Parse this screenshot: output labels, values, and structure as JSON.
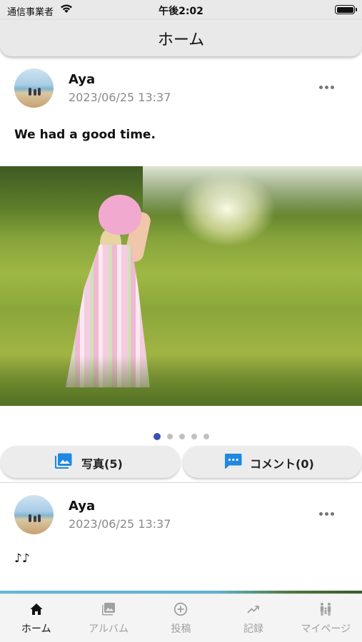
{
  "status_bar": {
    "carrier": "通信事業者",
    "time": "午後2:02"
  },
  "nav": {
    "title": "ホーム"
  },
  "posts": [
    {
      "author": "Aya",
      "date": "2023/06/25 13:37",
      "text": "We had a good time.",
      "carousel": {
        "count": 5,
        "active_index": 0
      },
      "photos_button": "写真(5)",
      "comments_button": "コメント(0)"
    },
    {
      "author": "Aya",
      "date": "2023/06/25 13:37",
      "text": "♪♪"
    }
  ],
  "tab_bar": {
    "items": [
      {
        "label": "ホーム",
        "icon": "home-icon",
        "active": true
      },
      {
        "label": "アルバム",
        "icon": "album-icon",
        "active": false
      },
      {
        "label": "投稿",
        "icon": "plus-circle-icon",
        "active": false
      },
      {
        "label": "記録",
        "icon": "trending-up-icon",
        "active": false
      },
      {
        "label": "マイページ",
        "icon": "family-icon",
        "active": false
      }
    ]
  },
  "colors": {
    "accent": "#3d4fb0",
    "icon_blue": "#1e88e5",
    "bar_background": "#e9e9e9"
  }
}
